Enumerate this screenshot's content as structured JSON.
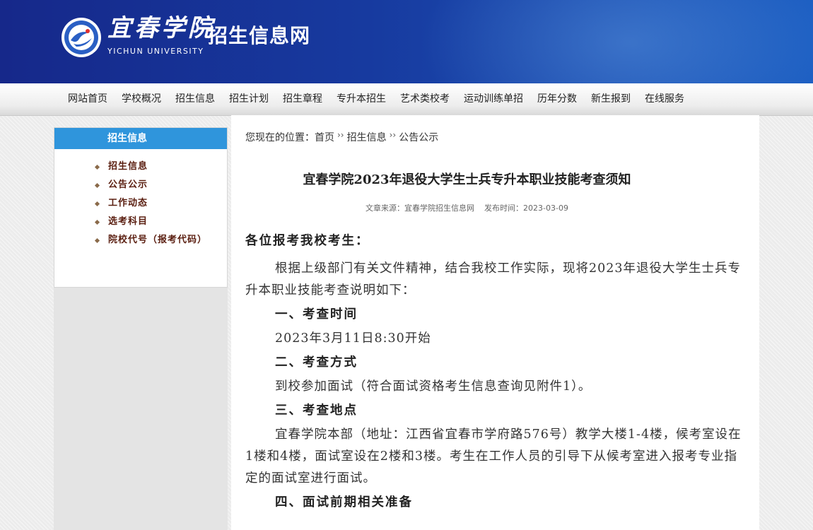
{
  "header": {
    "calligraphy_name": "宜春学院",
    "site_name": "招生信息网",
    "english_name": "YICHUN UNIVERSITY",
    "colors": {
      "primary": "#16288a",
      "accent": "#1c5ec2"
    }
  },
  "nav": {
    "items": [
      {
        "label": "网站首页"
      },
      {
        "label": "学校概况"
      },
      {
        "label": "招生信息"
      },
      {
        "label": "招生计划"
      },
      {
        "label": "招生章程"
      },
      {
        "label": "专升本招生"
      },
      {
        "label": "艺术类校考"
      },
      {
        "label": "运动训练单招"
      },
      {
        "label": "历年分数"
      },
      {
        "label": "新生报到"
      },
      {
        "label": "在线服务"
      }
    ]
  },
  "sidebar": {
    "title": "招生信息",
    "items": [
      {
        "label": "招生信息"
      },
      {
        "label": "公告公示"
      },
      {
        "label": "工作动态"
      },
      {
        "label": "选考科目"
      },
      {
        "label": "院校代号（报考代码）"
      }
    ]
  },
  "breadcrumb": {
    "prefix": "您现在的位置：",
    "separator": "››",
    "links": [
      {
        "label": "首页"
      },
      {
        "label": "招生信息"
      },
      {
        "label": "公告公示"
      }
    ]
  },
  "article": {
    "title": "宜春学院2023年退役大学生士兵专升本职业技能考查须知",
    "source": "文章来源：宜春学院招生信息网",
    "published": "发布时间：2023-03-09",
    "greeting": "各位报考我校考生：",
    "intro": "根据上级部门有关文件精神，结合我校工作实际，现将2023年退役大学生士兵专升本职业技能考查说明如下：",
    "sections": [
      {
        "heading": "一、考查时间",
        "text": "2023年3月11日8:30开始"
      },
      {
        "heading": "二、考查方式",
        "text": "到校参加面试（符合面试资格考生信息查询见附件1）。"
      },
      {
        "heading": "三、考查地点",
        "text": "宜春学院本部（地址：江西省宜春市学府路576号）教学大楼1-4楼，候考室设在1楼和4楼，面试室设在2楼和3楼。考生在工作人员的引导下从候考室进入报考专业指定的面试室进行面试。"
      },
      {
        "heading": "四、面试前期相关准备"
      }
    ]
  }
}
